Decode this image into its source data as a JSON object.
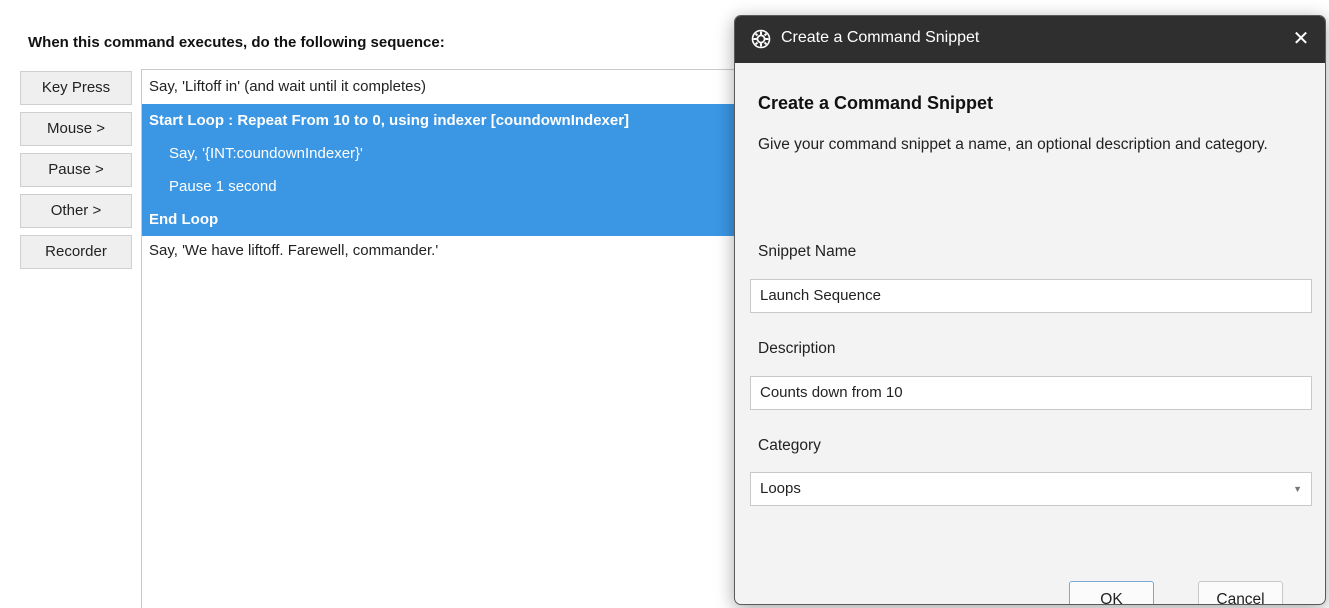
{
  "editor": {
    "heading": "When this command executes, do the following sequence:",
    "side_buttons": [
      "Key Press",
      "Mouse >",
      "Pause >",
      "Other >",
      "Recorder"
    ],
    "sequence": [
      "Say, 'Liftoff in'  (and wait until it completes)",
      "Start Loop : Repeat From 10 to 0, using indexer [coundownIndexer]",
      "Say, '{INT:coundownIndexer}'",
      "Pause 1 second",
      "End Loop",
      "Say, 'We have liftoff. Farewell, commander.'"
    ]
  },
  "dialog": {
    "title": "Create a Command Snippet",
    "close_glyph": "✕",
    "app_icon": "gear-icon",
    "heading": "Create a Command Snippet",
    "description": "Give your command snippet a name, an optional description and category.",
    "name_label": "Snippet Name",
    "name_value": "Launch Sequence",
    "description_label": "Description",
    "description_value": "Counts down from 10",
    "category_label": "Category",
    "category_value": "Loops",
    "ok_label": "OK",
    "cancel_label": "Cancel"
  },
  "colors": {
    "selection": "#3b96e3",
    "titlebar": "#2f2f2f"
  }
}
